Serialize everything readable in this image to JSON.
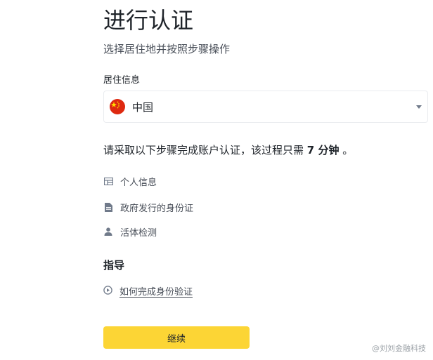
{
  "header": {
    "title": "进行认证",
    "subtitle": "选择居住地并按照步骤操作"
  },
  "residence": {
    "label": "居住信息",
    "selected_country": "中国",
    "flag_color": "#de2910"
  },
  "intro": {
    "prefix": "请采取以下步骤完成账户认证，该过程只需",
    "duration": "7 分钟",
    "suffix": "。"
  },
  "steps": [
    {
      "label": "个人信息",
      "icon": "id-card-icon"
    },
    {
      "label": "政府发行的身份证",
      "icon": "document-icon"
    },
    {
      "label": "活体检测",
      "icon": "person-icon"
    }
  ],
  "guide": {
    "title": "指导",
    "link_label": "如何完成身份验证",
    "link_icon": "play-circle-icon"
  },
  "actions": {
    "continue_label": "继续",
    "accent_color": "#fcd535"
  },
  "watermark": {
    "text": "@刘刘金融科技"
  }
}
